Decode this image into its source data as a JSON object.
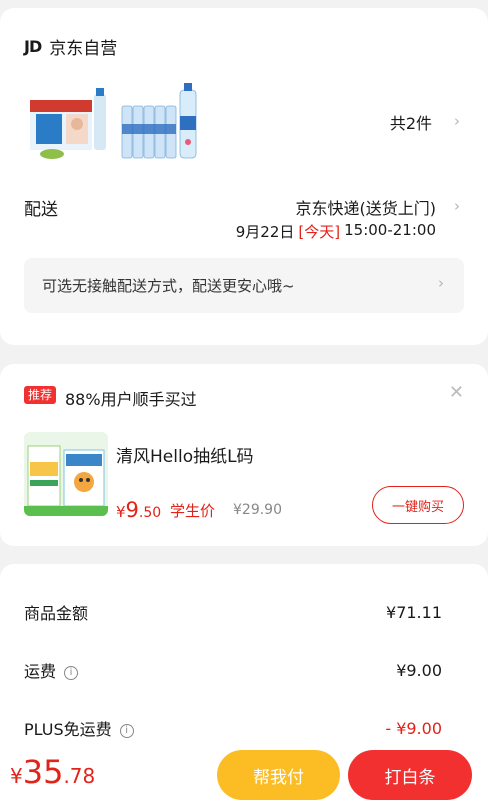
{
  "store": {
    "logo": "JD",
    "name": "京东自营",
    "item_count": "共2件",
    "delivery_label": "配送",
    "delivery_method": "京东快递(送货上门)",
    "delivery_date": "9月22日",
    "delivery_today": "[今天]",
    "delivery_window": "15:00-21:00",
    "notice": "可选无接触配送方式，配送更安心哦~"
  },
  "recommend": {
    "badge": "推荐",
    "text": "88%用户顺手买过",
    "title": "清风Hello抽纸L码",
    "price_symbol": "¥",
    "price_int": "9",
    "price_dec": ".50",
    "price_tag": "学生价",
    "original_price": "¥29.90",
    "buy_label": "一键购买"
  },
  "summary": {
    "rows": [
      {
        "label": "商品金额",
        "value": "¥71.11"
      },
      {
        "label": "运费",
        "value": "¥9.00"
      },
      {
        "label": "PLUS免运费",
        "value": "- ¥9.00"
      }
    ]
  },
  "footer": {
    "total_symbol": "¥",
    "total_int": "35",
    "total_dec": ".78",
    "help_pay_label": "帮我付",
    "baitiao_label": "打白条"
  },
  "colors": {
    "accent_red": "#e2231a",
    "yellow_button": "#fcbd24",
    "red_button": "#f23030"
  }
}
